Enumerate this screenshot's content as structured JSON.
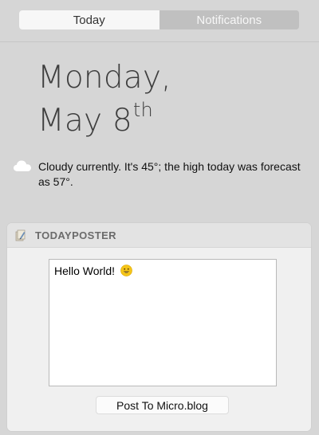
{
  "tabs": {
    "today": "Today",
    "notifications": "Notifications"
  },
  "date": {
    "weekday": "Monday,",
    "month_day": "May 8",
    "suffix": "th"
  },
  "weather": {
    "icon": "cloud-icon",
    "text": "Cloudy currently. It's 45°; the high today was forecast as 57°."
  },
  "widget": {
    "icon": "app-icon",
    "title": "TODAYPOSTER",
    "input_text": "Hello World!",
    "input_emoji": "grinning-face-icon",
    "button_label": "Post To Micro.blog"
  },
  "colors": {
    "background": "#d6d6d6",
    "tab_active": "#f7f7f7",
    "tab_inactive": "#c0c0c0",
    "widget_header": "#e3e3e3",
    "widget_body": "#f0f0f0"
  }
}
